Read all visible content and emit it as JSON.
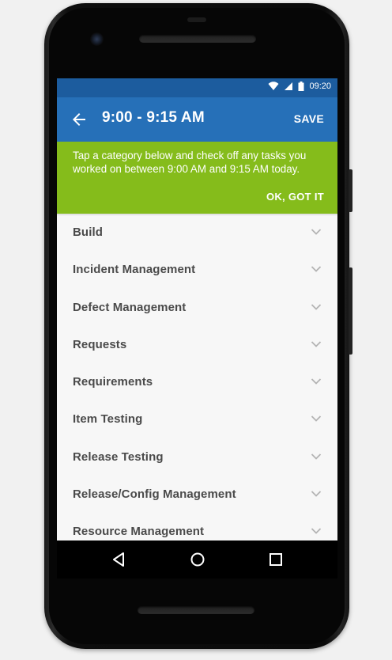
{
  "status_bar": {
    "time": "09:20",
    "icons": [
      "wifi-icon",
      "cell-signal-icon",
      "battery-icon"
    ]
  },
  "app_bar": {
    "title": "9:00 - 9:15 AM",
    "save_label": "SAVE",
    "back_icon": "arrow-back-icon"
  },
  "banner": {
    "message": "Tap a category below and check off any tasks you worked on between 9:00 AM and 9:15 AM today.",
    "dismiss_label": "OK, GOT IT"
  },
  "categories": [
    {
      "label": "Build"
    },
    {
      "label": "Incident Management"
    },
    {
      "label": "Defect Management"
    },
    {
      "label": "Requests"
    },
    {
      "label": "Requirements"
    },
    {
      "label": "Item Testing"
    },
    {
      "label": "Release Testing"
    },
    {
      "label": "Release/Config Management"
    },
    {
      "label": "Resource Management"
    }
  ],
  "nav_bar": {
    "back": "nav-back-icon",
    "home": "nav-home-icon",
    "recents": "nav-recents-icon"
  },
  "colors": {
    "status_bar": "#1c5c9e",
    "app_bar": "#2670b8",
    "banner": "#85bc1b",
    "list_bg": "#f7f7f7",
    "list_text": "#4a4a4a"
  }
}
